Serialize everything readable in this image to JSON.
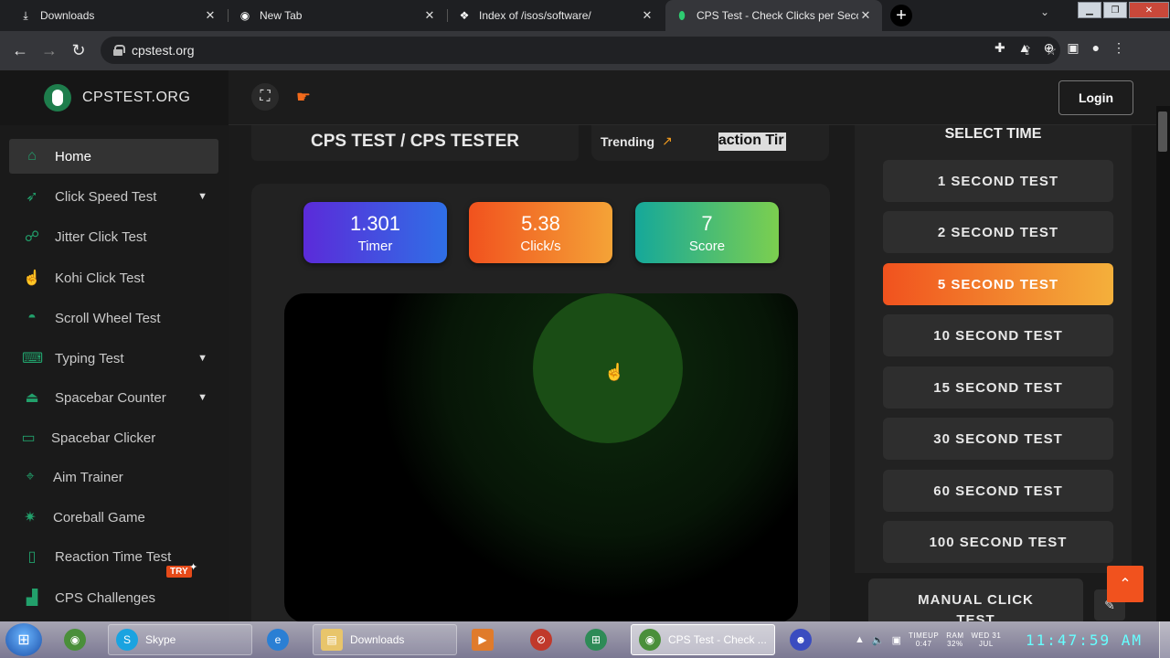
{
  "browser": {
    "tabs": [
      {
        "label": "Downloads",
        "icon": "download-icon"
      },
      {
        "label": "New Tab",
        "icon": "chrome-icon"
      },
      {
        "label": "Index of /isos/software/",
        "icon": "page-icon"
      },
      {
        "label": "CPS Test - Check Clicks per Seco",
        "icon": "shield-icon"
      }
    ],
    "url": "cpstest.org"
  },
  "site": {
    "brand": "CPSTEST.ORG",
    "login_label": "Login",
    "page_title": "CPS TEST / CPS TESTER",
    "trending_label": "Trending",
    "trending_ticker": "action Tir"
  },
  "sidebar": {
    "items": [
      {
        "label": "Home",
        "icon": "home-icon",
        "has_submenu": false
      },
      {
        "label": "Click Speed Test",
        "icon": "cursor-click-icon",
        "has_submenu": true
      },
      {
        "label": "Jitter Click Test",
        "icon": "jitter-icon",
        "has_submenu": false
      },
      {
        "label": "Kohi Click Test",
        "icon": "finger-icon",
        "has_submenu": false
      },
      {
        "label": "Scroll Wheel Test",
        "icon": "mouse-icon",
        "has_submenu": false
      },
      {
        "label": "Typing Test",
        "icon": "keyboard-icon",
        "has_submenu": true
      },
      {
        "label": "Spacebar Counter",
        "icon": "spacebar-icon",
        "has_submenu": true
      },
      {
        "label": "Spacebar Clicker",
        "icon": "spacebar-key-icon",
        "has_submenu": false
      },
      {
        "label": "Aim Trainer",
        "icon": "crosshair-icon",
        "has_submenu": false
      },
      {
        "label": "Coreball Game",
        "icon": "coreball-icon",
        "has_submenu": false
      },
      {
        "label": "Reaction Time Test",
        "icon": "phone-icon",
        "has_submenu": false
      },
      {
        "label": "CPS Challenges",
        "icon": "bars-icon",
        "has_submenu": false
      }
    ],
    "try_badge": "TRY"
  },
  "stats": {
    "timer": {
      "value": "1.301",
      "label": "Timer"
    },
    "clicks": {
      "value": "5.38",
      "label": "Click/s"
    },
    "score": {
      "value": "7",
      "label": "Score"
    }
  },
  "time_select": {
    "title": "SELECT TIME",
    "options": [
      "1 SECOND TEST",
      "2 SECOND TEST",
      "5 SECOND TEST",
      "10 SECOND TEST",
      "15 SECOND TEST",
      "30 SECOND TEST",
      "60 SECOND TEST",
      "100 SECOND TEST"
    ],
    "selected": "5 SECOND TEST",
    "manual_line1": "MANUAL CLICK",
    "manual_line2": "TEST"
  },
  "taskbar": {
    "items": [
      {
        "label": "",
        "icon": "chrome-taskbar-icon"
      },
      {
        "label": "Skype",
        "icon": "skype-icon"
      },
      {
        "label": "",
        "icon": "ie-icon"
      },
      {
        "label": "Downloads",
        "icon": "folder-icon"
      },
      {
        "label": "",
        "icon": "media-icon"
      },
      {
        "label": "",
        "icon": "blocked-icon"
      },
      {
        "label": "",
        "icon": "windows-icon"
      },
      {
        "label": "CPS Test - Check ...",
        "icon": "chrome-taskbar-icon"
      },
      {
        "label": "",
        "icon": "wizard-icon"
      }
    ],
    "meters": [
      {
        "top": "TIMEUP",
        "bottom": "0:47"
      },
      {
        "top": "RAM",
        "bottom": "32%"
      },
      {
        "top": "WED 31",
        "bottom": "JUL"
      }
    ],
    "clock": "11:47:59 AM"
  },
  "colors": {
    "accent_orange": "#f1521e",
    "brand_green": "#22a06b"
  }
}
